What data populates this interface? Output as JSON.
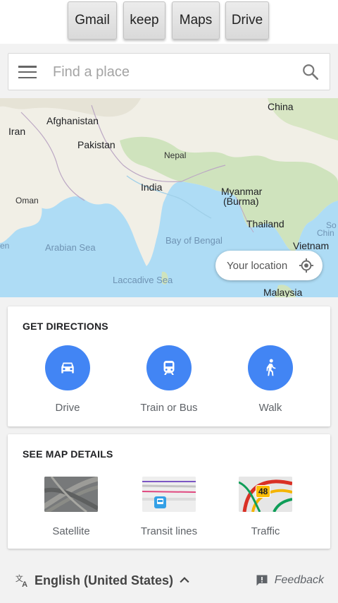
{
  "apps": {
    "buttons": [
      {
        "label": "Gmail"
      },
      {
        "label": "keep"
      },
      {
        "label": "Maps"
      },
      {
        "label": "Drive"
      }
    ]
  },
  "search": {
    "placeholder": "Find a place",
    "menu_icon": "hamburger-menu-icon",
    "search_icon": "search-icon"
  },
  "map": {
    "labels": {
      "china": "China",
      "afghanistan": "Afghanistan",
      "iran": "Iran",
      "pakistan": "Pakistan",
      "nepal": "Nepal",
      "india": "India",
      "myanmar_line1": "Myanmar",
      "myanmar_line2": "(Burma)",
      "oman": "Oman",
      "thailand": "Thailand",
      "south_china_line1": "So",
      "south_china_line2": "Chin",
      "en": "en",
      "arabian_sea": "Arabian Sea",
      "bay_of_bengal": "Bay of Bengal",
      "vietnam": "Vietnam",
      "laccadive_sea": "Laccadive Sea",
      "malaysia": "Malaysia"
    },
    "your_location": "Your location",
    "location_icon": "my-location-icon"
  },
  "directions": {
    "title": "GET DIRECTIONS",
    "items": [
      {
        "label": "Drive",
        "icon": "car-icon"
      },
      {
        "label": "Train or Bus",
        "icon": "train-icon"
      },
      {
        "label": "Walk",
        "icon": "walk-icon"
      }
    ]
  },
  "map_details": {
    "title": "SEE MAP DETAILS",
    "items": [
      {
        "label": "Satellite"
      },
      {
        "label": "Transit lines"
      },
      {
        "label": "Traffic",
        "badge": "48"
      }
    ]
  },
  "footer": {
    "language": "English (United States)",
    "feedback": "Feedback"
  },
  "colors": {
    "accent": "#4285f4",
    "water": "#aedcf5",
    "land": "#f1efe6"
  }
}
